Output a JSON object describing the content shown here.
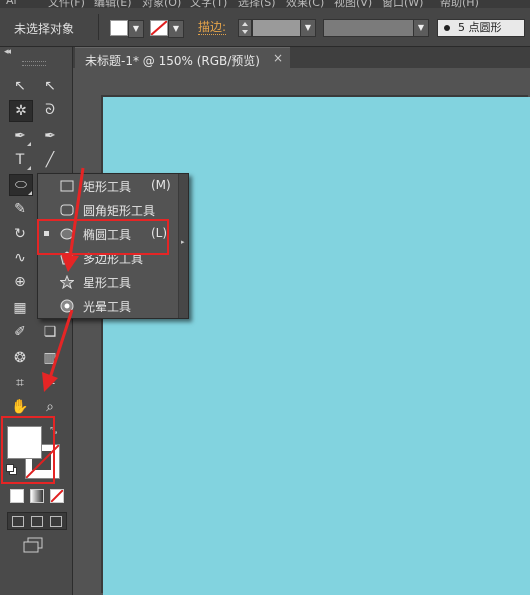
{
  "menubar": {
    "items": [
      "Ai",
      "文件(F)",
      "编辑(E)",
      "对象(O)",
      "文字(T)",
      "选择(S)",
      "效果(C)",
      "视图(V)",
      "窗口(W)",
      "帮助(H)"
    ]
  },
  "control_bar": {
    "selection_label": "未选择对象",
    "stroke_label": "描边",
    "stroke_colon": ":",
    "brush_label": "5 点圆形"
  },
  "panel_collapse": "◂◂",
  "document_tab": {
    "title": "未标题-1* @ 150% (RGB/预览)",
    "close": "×"
  },
  "tools": [
    {
      "name": "selection-tool-icon",
      "glyph": "↖"
    },
    {
      "name": "direct-selection-tool-icon",
      "glyph": "↖"
    },
    {
      "name": "magic-wand-tool-icon",
      "glyph": "✲"
    },
    {
      "name": "lasso-tool-icon",
      "glyph": "ᘐ"
    },
    {
      "name": "pen-tool-icon",
      "glyph": "✒"
    },
    {
      "name": "curvature-tool-icon",
      "glyph": "✒"
    },
    {
      "name": "type-tool-icon",
      "glyph": "T"
    },
    {
      "name": "line-segment-tool-icon",
      "glyph": "╱"
    },
    {
      "name": "ellipse-tool-icon",
      "glyph": "⬭"
    },
    {
      "name": "paintbrush-tool-icon",
      "glyph": "✎"
    },
    {
      "name": "rotate-tool-icon",
      "glyph": "↻"
    },
    {
      "name": "warp-tool-icon",
      "glyph": "∿"
    },
    {
      "name": "shape-builder-tool-icon",
      "glyph": "⊕"
    },
    {
      "name": "perspective-grid-tool-icon",
      "glyph": "▦"
    },
    {
      "name": "eyedropper-tool-icon",
      "glyph": "✐"
    },
    {
      "name": "blend-tool-icon",
      "glyph": "❏"
    },
    {
      "name": "symbol-sprayer-tool-icon",
      "glyph": "❂"
    },
    {
      "name": "column-graph-tool-icon",
      "glyph": "▥"
    },
    {
      "name": "artboard-tool-icon",
      "glyph": "⌗"
    },
    {
      "name": "slice-tool-icon",
      "glyph": "✂"
    },
    {
      "name": "hand-tool-icon",
      "glyph": "✋"
    },
    {
      "name": "zoom-tool-icon",
      "glyph": "⌕"
    }
  ],
  "flyout": {
    "items": [
      {
        "label": "矩形工具",
        "key": "(M)",
        "icon": "rectangle-tool-icon",
        "selected": false
      },
      {
        "label": "圆角矩形工具",
        "key": "",
        "icon": "rounded-rectangle-tool-icon",
        "selected": false
      },
      {
        "label": "椭圆工具",
        "key": "(L)",
        "icon": "ellipse-tool-icon",
        "selected": true
      },
      {
        "label": "多边形工具",
        "key": "",
        "icon": "polygon-tool-icon",
        "selected": false
      },
      {
        "label": "星形工具",
        "key": "",
        "icon": "star-tool-icon",
        "selected": false
      },
      {
        "label": "光晕工具",
        "key": "",
        "icon": "flare-tool-icon",
        "selected": false
      }
    ]
  },
  "colors": {
    "canvas": "#82d3df",
    "highlight": "#e52525",
    "stroke_label": "#e3a34a"
  }
}
